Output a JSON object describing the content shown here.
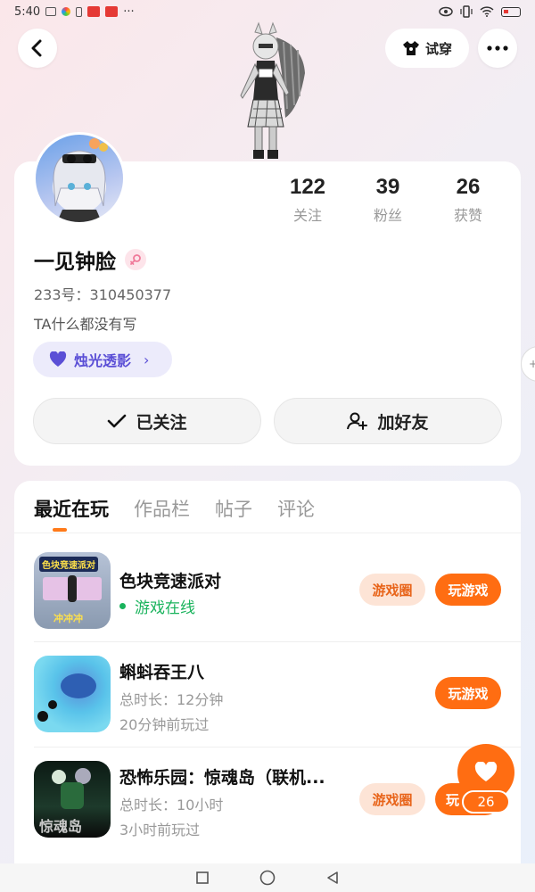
{
  "status_bar": {
    "time": "5:40",
    "dots": "···",
    "icons": [
      "message-icon",
      "flower-icon",
      "battery-small-icon",
      "app-badge-icon",
      "app-badge-icon",
      "eye-icon",
      "vibrate-icon",
      "wifi-icon",
      "battery-icon"
    ]
  },
  "header": {
    "try_on_label": "试穿",
    "back_icon": "chevron-left-icon",
    "more_icon": "more-dots-icon",
    "tshirt_icon": "tshirt-icon"
  },
  "profile": {
    "following_count": "122",
    "following_label": "关注",
    "fans_count": "39",
    "fans_label": "粉丝",
    "likes_count": "26",
    "likes_label": "获赞",
    "nickname": "一见钟脸",
    "gender": "female",
    "uid": "233号：310450377",
    "bio": "TA什么都没有写",
    "tag_label": "烛光透影",
    "tag_color": "#5b4fd6",
    "followed_button": "已关注",
    "add_friend_button": "加好友"
  },
  "tabs": [
    {
      "label": "最近在玩",
      "active": true
    },
    {
      "label": "作品栏",
      "active": false
    },
    {
      "label": "帖子",
      "active": false
    },
    {
      "label": "评论",
      "active": false
    }
  ],
  "games": [
    {
      "title": "色块竞速派对",
      "icon_text_top": "色块竞速派对",
      "icon_text_bottom": "冲冲冲",
      "status": "游戏在线",
      "circle_button": "游戏圈",
      "play_button": "玩游戏"
    },
    {
      "title": "蝌蚪吞王八",
      "duration": "总时长：12分钟",
      "last_played": "20分钟前玩过",
      "play_button": "玩游戏"
    },
    {
      "title": "恐怖乐园：惊魂岛（联机...",
      "icon_text": "惊魂岛",
      "duration": "总时长：10小时",
      "last_played": "3小时前玩过",
      "circle_button": "游戏圈",
      "play_button": "玩"
    }
  ],
  "fab": {
    "like_count": "26",
    "icon": "heart-icon"
  },
  "colors": {
    "accent": "#ff6d12",
    "online": "#19b35c",
    "tag_bg": "#ecebfb"
  }
}
